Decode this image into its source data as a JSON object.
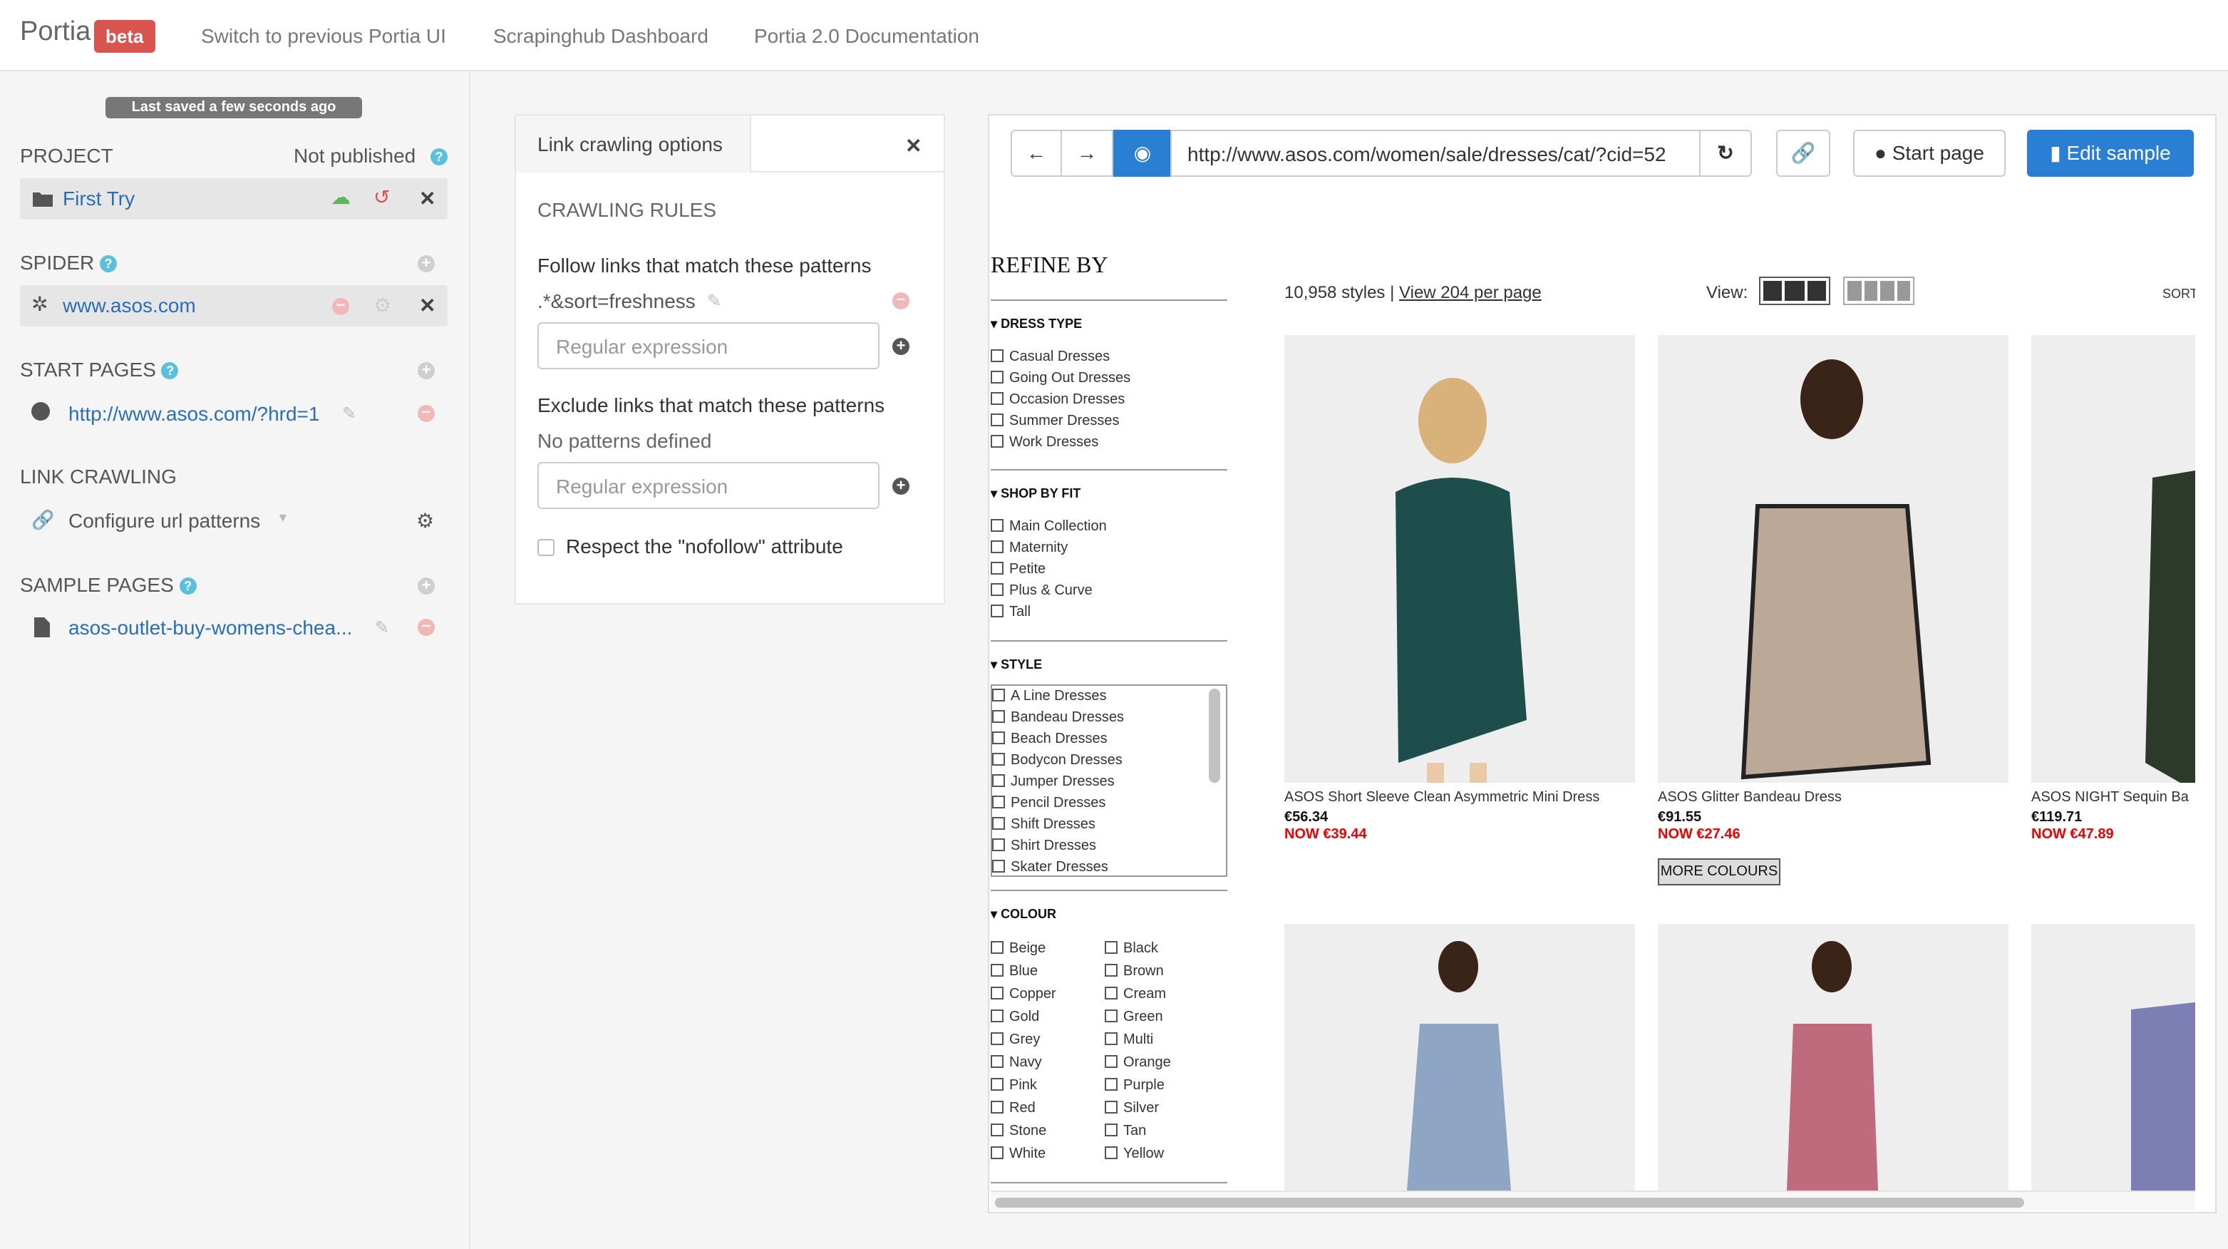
{
  "nav": {
    "brand": "Portia",
    "beta": "beta",
    "links": [
      "Switch to previous Portia UI",
      "Scrapinghub Dashboard",
      "Portia 2.0 Documentation"
    ]
  },
  "sidebar": {
    "saved": "Last saved a few seconds ago",
    "project": {
      "heading": "PROJECT",
      "status": "Not published",
      "name": "First Try"
    },
    "spider": {
      "heading": "SPIDER",
      "name": "www.asos.com"
    },
    "start_pages": {
      "heading": "START PAGES",
      "url": "http://www.asos.com/?hrd=1"
    },
    "link_crawling": {
      "heading": "LINK CRAWLING",
      "label": "Configure url patterns"
    },
    "sample_pages": {
      "heading": "SAMPLE PAGES",
      "name": "asos-outlet-buy-womens-chea..."
    }
  },
  "link_crawling": {
    "tab": "Link crawling options",
    "rules_heading": "CRAWLING RULES",
    "follow_label": "Follow links that match these patterns",
    "follow_pattern": ".*&sort=freshness",
    "placeholder": "Regular expression",
    "exclude_label": "Exclude links that match these patterns",
    "no_patterns": "No patterns defined",
    "nofollow_label": "Respect the \"nofollow\" attribute"
  },
  "browser": {
    "url": "http://www.asos.com/women/sale/dresses/cat/?cid=52",
    "start_page": "Start page",
    "edit_sample": "Edit sample",
    "accent": "#2a7fd4"
  },
  "site": {
    "refine": "REFINE BY",
    "count": "10,958 styles",
    "view_per_page": "View 204 per page",
    "view": "View:",
    "sort": "SORT",
    "dress_type": {
      "heading": "DRESS TYPE",
      "items": [
        "Casual Dresses",
        "Going Out Dresses",
        "Occasion Dresses",
        "Summer Dresses",
        "Work Dresses"
      ]
    },
    "shop_by_fit": {
      "heading": "SHOP BY FIT",
      "items": [
        "Main Collection",
        "Maternity",
        "Petite",
        "Plus & Curve",
        "Tall"
      ]
    },
    "style": {
      "heading": "STYLE",
      "items": [
        "A Line Dresses",
        "Bandeau Dresses",
        "Beach Dresses",
        "Bodycon Dresses",
        "Jumper Dresses",
        "Pencil Dresses",
        "Shift Dresses",
        "Shirt Dresses",
        "Skater Dresses"
      ]
    },
    "colour": {
      "heading": "COLOUR",
      "left": [
        "Beige",
        "Blue",
        "Copper",
        "Gold",
        "Grey",
        "Navy",
        "Pink",
        "Red",
        "Stone",
        "White"
      ],
      "right": [
        "Black",
        "Brown",
        "Cream",
        "Green",
        "Multi",
        "Orange",
        "Purple",
        "Silver",
        "Tan",
        "Yellow"
      ]
    },
    "products": [
      {
        "name": "ASOS Short Sleeve Clean Asymmetric Mini Dress",
        "price": "€56.34",
        "now": "NOW €39.44"
      },
      {
        "name": "ASOS Glitter Bandeau Dress",
        "price": "€91.55",
        "now": "NOW €27.46",
        "extra": "MORE COLOURS"
      },
      {
        "name": "ASOS NIGHT Sequin Ba",
        "price": "€119.71",
        "now": "NOW €47.89"
      }
    ]
  }
}
